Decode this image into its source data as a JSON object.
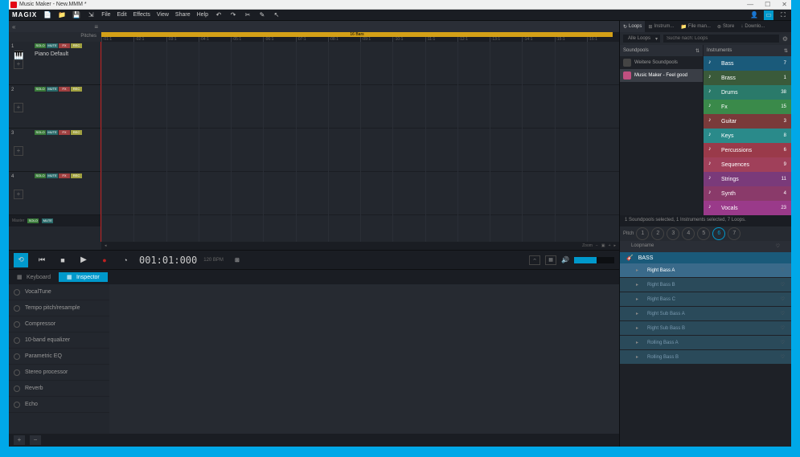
{
  "window": {
    "title": "Music Maker - New.MMM *"
  },
  "brand": "MAGIX",
  "menu": [
    "File",
    "Edit",
    "Effects",
    "View",
    "Share",
    "Help"
  ],
  "ruler_label": "16 Bars",
  "ticks": [
    ":01:1",
    ":02:1",
    ":03:1",
    ":04:1",
    ":05:1",
    ":06:1",
    ":07:1",
    ":08:1",
    ":09:1",
    ":10:1",
    ":11:1",
    ":12:1",
    ":13:1",
    ":14:1",
    ":15:1",
    ":16:1"
  ],
  "pitches_label": "Pitches",
  "tracks": [
    {
      "num": "1",
      "name": "Piano Default",
      "solo": "SOLO",
      "mute": "MUTE",
      "fx": "FX",
      "rec": "REC",
      "has_inst": true
    },
    {
      "num": "2",
      "name": "",
      "solo": "SOLO",
      "mute": "MUTE",
      "fx": "FX",
      "rec": "REC",
      "has_inst": false
    },
    {
      "num": "3",
      "name": "",
      "solo": "SOLO",
      "mute": "MUTE",
      "fx": "FX",
      "rec": "REC",
      "has_inst": false
    },
    {
      "num": "4",
      "name": "",
      "solo": "SOLO",
      "mute": "MUTE",
      "fx": "FX",
      "rec": "REC",
      "has_inst": false
    }
  ],
  "master": {
    "label": "Master",
    "solo": "SOLO",
    "mute": "MUTE"
  },
  "zoom_label": "Zoom",
  "transport": {
    "time": "001:01:000",
    "bpm": "120 BPM",
    "vol_pct": 55
  },
  "bottom_tabs": [
    {
      "label": "Keyboard",
      "active": false
    },
    {
      "label": "Inspector",
      "active": true
    }
  ],
  "fx": [
    "VocalTune",
    "Tempo pitch/resample",
    "Compressor",
    "10-band equalizer",
    "Parametric EQ",
    "Stereo processor",
    "Reverb",
    "Echo"
  ],
  "right_tabs": [
    {
      "label": "Loops",
      "icon": "↻",
      "active": true
    },
    {
      "label": "Instrum...",
      "icon": "⊞",
      "active": false
    },
    {
      "label": "File man...",
      "icon": "📁",
      "active": false
    },
    {
      "label": "Store",
      "icon": "⊛",
      "active": false
    },
    {
      "label": "Downlo...",
      "icon": "↓",
      "active": false
    }
  ],
  "filter_label": "Alle Loops",
  "search_placeholder": "Suche nach: Loops",
  "col_headers": {
    "left": "Soundpools",
    "right": "Instruments"
  },
  "soundpools": [
    {
      "name": "Weitere Soundpools",
      "sel": false,
      "pink": false
    },
    {
      "name": "Music Maker - Feel good",
      "sel": true,
      "pink": true
    }
  ],
  "instruments": [
    {
      "name": "Bass",
      "count": "7",
      "color": "#2a6a8a",
      "sel": true
    },
    {
      "name": "Brass",
      "count": "1",
      "color": "#3a5a3a",
      "sel": false
    },
    {
      "name": "Drums",
      "count": "38",
      "color": "#2a7a6a",
      "sel": false
    },
    {
      "name": "Fx",
      "count": "15",
      "color": "#3a8a4a",
      "sel": false
    },
    {
      "name": "Guitar",
      "count": "3",
      "color": "#7a3a3a",
      "sel": false
    },
    {
      "name": "Keys",
      "count": "8",
      "color": "#2a8a8a",
      "sel": false
    },
    {
      "name": "Percussions",
      "count": "6",
      "color": "#9a3a4a",
      "sel": false
    },
    {
      "name": "Sequences",
      "count": "9",
      "color": "#a0405a",
      "sel": false
    },
    {
      "name": "Strings",
      "count": "11",
      "color": "#7a3a7a",
      "sel": false
    },
    {
      "name": "Synth",
      "count": "4",
      "color": "#8a3a6a",
      "sel": false
    },
    {
      "name": "Vocals",
      "count": "23",
      "color": "#9a3a8a",
      "sel": false
    }
  ],
  "status": "1 Soundpools selected, 1 Instruments selected, 7 Loops.",
  "pitch_label": "Pitch",
  "pitches": [
    "1",
    "2",
    "3",
    "4",
    "5",
    "6",
    "7"
  ],
  "pitch_active": 5,
  "loopname_label": "Loopname",
  "loop_group": "BASS",
  "loops": [
    {
      "name": "Right Bass A",
      "sel": true
    },
    {
      "name": "Right Bass B",
      "sel": false
    },
    {
      "name": "Right Bass C",
      "sel": false
    },
    {
      "name": "Right Sub Bass A",
      "sel": false
    },
    {
      "name": "Right Sub Bass B",
      "sel": false
    },
    {
      "name": "Rolling Bass A",
      "sel": false
    },
    {
      "name": "Rolling Bass B",
      "sel": false
    }
  ]
}
